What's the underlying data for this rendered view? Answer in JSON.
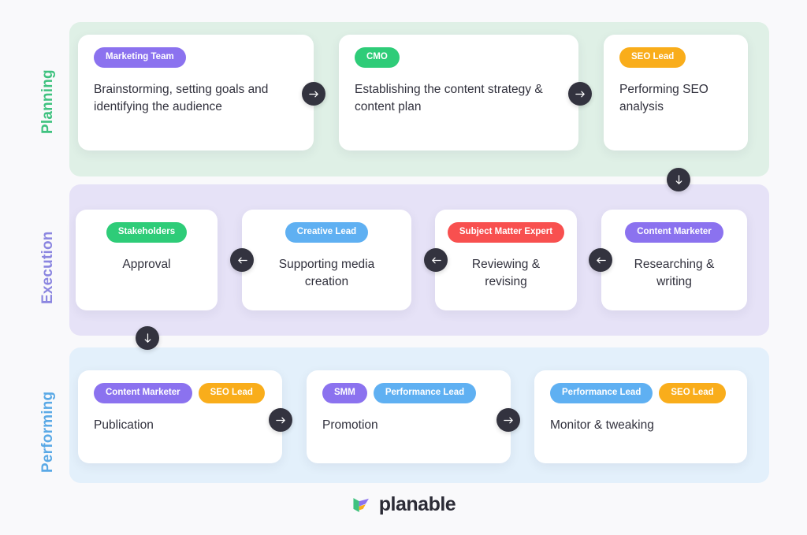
{
  "stages": [
    {
      "label": "Planning",
      "color": "#3fc27f",
      "band_color": "#dff0e6"
    },
    {
      "label": "Execution",
      "color": "#8b86e0",
      "band_color": "#e6e2f7"
    },
    {
      "label": "Performing",
      "color": "#5aa9e6",
      "band_color": "#e3f0fb"
    }
  ],
  "palette": {
    "purple": "#8b72ef",
    "green": "#2ecc78",
    "orange": "#f9ad1b",
    "blue": "#5fb0f2",
    "red": "#f8504f",
    "dark": "#33333f",
    "text": "#31313d",
    "page_bg": "#f9f9fb"
  },
  "planning": {
    "cards": [
      {
        "badges": [
          {
            "label": "Marketing Team",
            "color": "#8b72ef"
          }
        ],
        "text": "Brainstorming, setting goals and identifying the audience"
      },
      {
        "badges": [
          {
            "label": "CMO",
            "color": "#2ecc78"
          }
        ],
        "text": "Establishing the content strategy & content plan"
      },
      {
        "badges": [
          {
            "label": "SEO Lead",
            "color": "#f9ad1b"
          }
        ],
        "text": "Performing SEO analysis"
      }
    ]
  },
  "execution": {
    "cards": [
      {
        "badges": [
          {
            "label": "Stakeholders",
            "color": "#2ecc78"
          }
        ],
        "text": "Approval"
      },
      {
        "badges": [
          {
            "label": "Creative Lead",
            "color": "#5fb0f2"
          }
        ],
        "text": "Supporting media creation"
      },
      {
        "badges": [
          {
            "label": "Subject Matter Expert",
            "color": "#f8504f"
          }
        ],
        "text": "Reviewing & revising"
      },
      {
        "badges": [
          {
            "label": "Content Marketer",
            "color": "#8b72ef"
          }
        ],
        "text": "Researching & writing"
      }
    ]
  },
  "performing": {
    "cards": [
      {
        "badges": [
          {
            "label": "Content Marketer",
            "color": "#8b72ef"
          },
          {
            "label": "SEO Lead",
            "color": "#f9ad1b"
          }
        ],
        "text": "Publication"
      },
      {
        "badges": [
          {
            "label": "SMM",
            "color": "#8b72ef"
          },
          {
            "label": "Performance Lead",
            "color": "#5fb0f2"
          }
        ],
        "text": "Promotion"
      },
      {
        "badges": [
          {
            "label": "Performance Lead",
            "color": "#5fb0f2"
          },
          {
            "label": "SEO Lead",
            "color": "#f9ad1b"
          }
        ],
        "text": "Monitor & tweaking"
      }
    ]
  },
  "connectors": [
    {
      "name": "planning-arrow-1",
      "direction": "right"
    },
    {
      "name": "planning-arrow-2",
      "direction": "right"
    },
    {
      "name": "planning-to-execution",
      "direction": "down"
    },
    {
      "name": "execution-arrow-1",
      "direction": "left"
    },
    {
      "name": "execution-arrow-2",
      "direction": "left"
    },
    {
      "name": "execution-arrow-3",
      "direction": "left"
    },
    {
      "name": "execution-to-performing",
      "direction": "down"
    },
    {
      "name": "performing-arrow-1",
      "direction": "right"
    },
    {
      "name": "performing-arrow-2",
      "direction": "right"
    }
  ],
  "footer": {
    "brand": "planable",
    "logo_icon": "planable-logo-mark"
  }
}
